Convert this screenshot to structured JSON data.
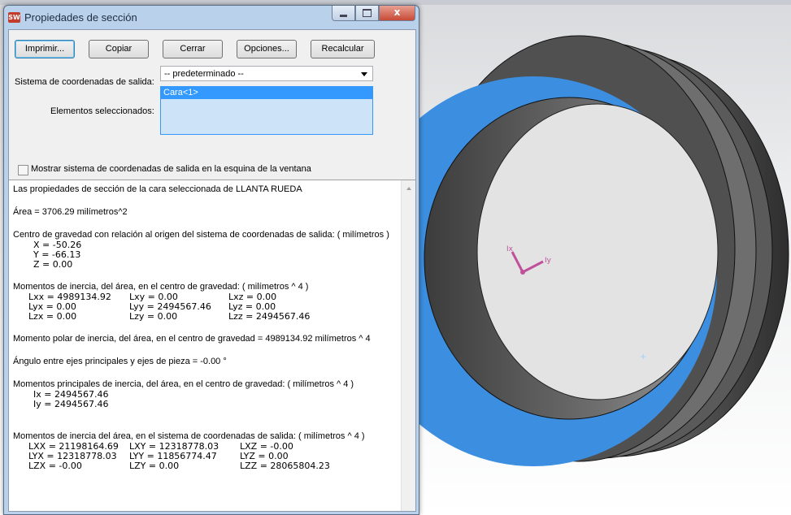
{
  "window": {
    "title": "Propiedades de sección",
    "close_glyph": "x"
  },
  "buttons": {
    "print": "Imprimir...",
    "copy": "Copiar",
    "close": "Cerrar",
    "options": "Opciones...",
    "recalc": "Recalcular"
  },
  "coord_label": "Sistema de coordenadas de salida:",
  "coord_value": "-- predeterminado --",
  "selected_label": "Elementos seleccionados:",
  "selected_items": [
    "Cara<1>"
  ],
  "show_coord_checkbox": {
    "label": "Mostrar sistema de coordenadas de salida en la esquina de la ventana",
    "checked": false
  },
  "results": {
    "header": "Las propiedades de sección de la cara seleccionada de LLANTA RUEDA",
    "area": "Área = 3706.29 milímetros^2",
    "cg_header": "Centro de gravedad con relación al origen del sistema de coordenadas de salida: ( milímetros )",
    "cg": [
      "X = -50.26",
      "Y = -66.13",
      "Z = 0.00"
    ],
    "inertia_cg_header": "Momentos de inercia, del área, en el centro de gravedad: ( milímetros ^ 4 )",
    "inertia_cg": [
      [
        "Lxx = 4989134.92",
        "Lxy = 0.00",
        "Lxz = 0.00"
      ],
      [
        "Lyx = 0.00",
        "Lyy = 2494567.46",
        "Lyz = 0.00"
      ],
      [
        "Lzx = 0.00",
        "Lzy = 0.00",
        "Lzz = 2494567.46"
      ]
    ],
    "polar": "Momento polar de inercia, del área, en el centro de gravedad = 4989134.92 milímetros ^ 4",
    "angle": "Ángulo entre ejes principales y ejes de pieza = -0.00 °",
    "principal_header": "Momentos principales de inercia, del área, en el centro de gravedad: ( milímetros ^ 4 )",
    "principal": [
      "Ix = 2494567.46",
      "Iy = 2494567.46"
    ],
    "inertia_out_header": "Momentos de inercia del área, en el sistema de coordenadas de salida: ( milímetros ^ 4 )",
    "inertia_out": [
      [
        "LXX = 21198164.69",
        "LXY = 12318778.03",
        "LXZ = -0.00"
      ],
      [
        "LYX = 12318778.03",
        "LYY = 11856774.47",
        "LYZ = 0.00"
      ],
      [
        "LZX = -0.00",
        "LZY = 0.00",
        "LZZ = 28065804.23"
      ]
    ]
  },
  "viewport": {
    "triad_labels": {
      "x": "Ix",
      "y": "Iy"
    },
    "colors": {
      "face": "#3c8ee0",
      "tire": "#4c4c4c",
      "triad": "#c0509a"
    }
  }
}
